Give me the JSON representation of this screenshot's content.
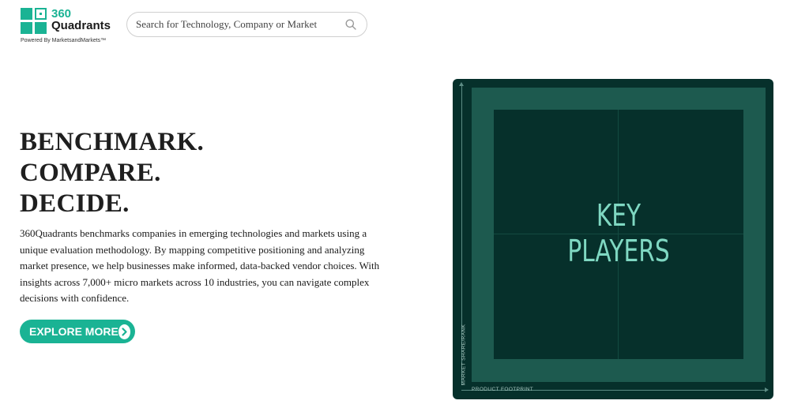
{
  "header": {
    "logo": {
      "line1": "360",
      "line2": "Quadrants",
      "powered_by": "Powered By MarketsandMarkets™"
    },
    "search": {
      "placeholder": "Search for Technology, Company or Market",
      "value": ""
    }
  },
  "hero": {
    "headline": [
      "BENCHMARK.",
      "COMPARE.",
      "DECIDE."
    ],
    "description": "360Quadrants benchmarks companies in emerging technologies and markets using a unique evaluation methodology. By mapping competitive positioning and analyzing market presence, we help businesses make informed, data-backed vendor choices. With insights across 7,000+ micro markets across 10 industries, you can navigate complex decisions with confidence.",
    "cta_label": "EXPLORE MORE"
  },
  "quadrant": {
    "title_line1": "KEY",
    "title_line2": "PLAYERS",
    "y_axis_label": "MARKET SHARE/RANK",
    "x_axis_label": "PRODUCT FOOTPRINT"
  },
  "colors": {
    "brand_green": "#1ab394",
    "panel_dark": "#06302b",
    "panel_mid": "#1d5a4f",
    "key_players_text": "#7fd8c2"
  },
  "icons": {
    "search": "magnifier-icon",
    "cta": "chevron-right-circle-icon",
    "logo": "four-squares-logo-icon"
  }
}
